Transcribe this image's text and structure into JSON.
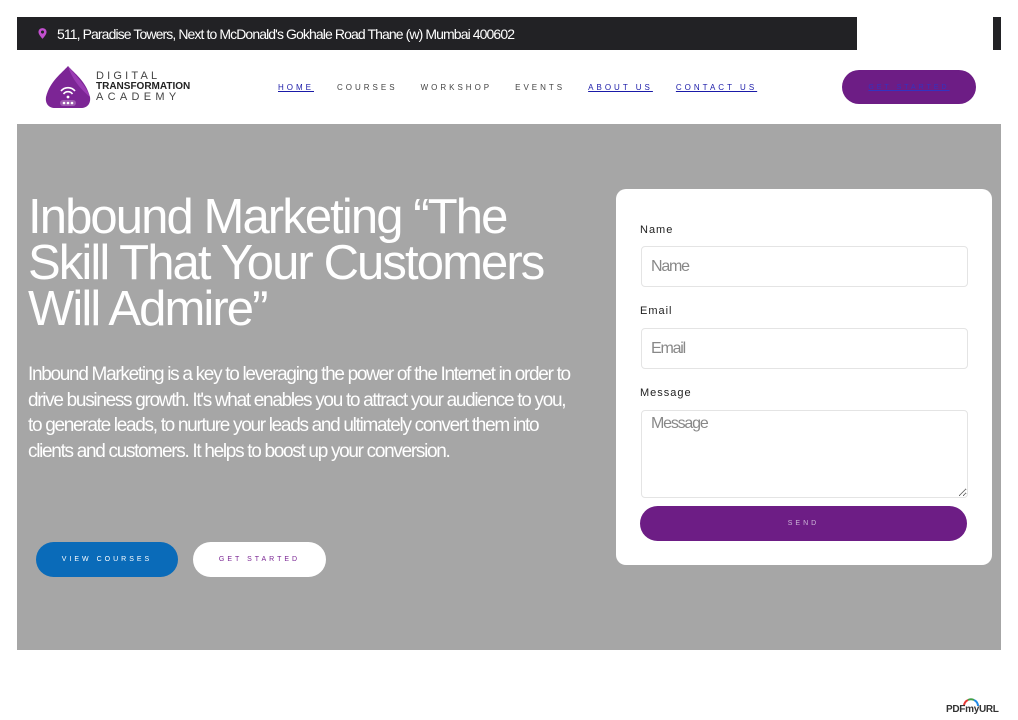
{
  "topbar": {
    "address": "511, Paradise Towers, Next to McDonald's Gokhale Road Thane (w) Mumbai 400602",
    "social_links": [
      "",
      "",
      "",
      "",
      ""
    ],
    "pin_color": "#c24fce"
  },
  "header": {
    "logo_line1": "DIGITAL",
    "logo_line2": "TRANSFORMATION",
    "logo_line3": "ACADEMY",
    "nav": [
      "HOME",
      "COURSES",
      "WORKSHOP",
      "EVENTS",
      "ABOUT US",
      "CONTACT US"
    ],
    "cta": "GET STARTED"
  },
  "hero": {
    "title": "Inbound Marketing “The Skill That Your Customers Will Admire”",
    "body": "Inbound Marketing is a key to leveraging the power of the Internet in order to drive business growth. It's what enables you to attract your audience to you, to generate leads, to nurture your leads and ultimately convert them into clients and customers. It helps to boost up your conversion.",
    "btn_courses": "VIEW COURSES",
    "btn_start": "GET STARTED"
  },
  "form": {
    "name_label": "Name",
    "name_placeholder": "Name",
    "email_label": "Email",
    "email_placeholder": "Email",
    "message_label": "Message",
    "message_placeholder": "Message",
    "send": "SEND"
  },
  "watermark": "PDFmyURL",
  "colors": {
    "brand_purple": "#6d1d85",
    "accent_blue": "#0a6bb9",
    "hero_bg": "#a6a6a6",
    "topbar_bg": "#222225"
  }
}
